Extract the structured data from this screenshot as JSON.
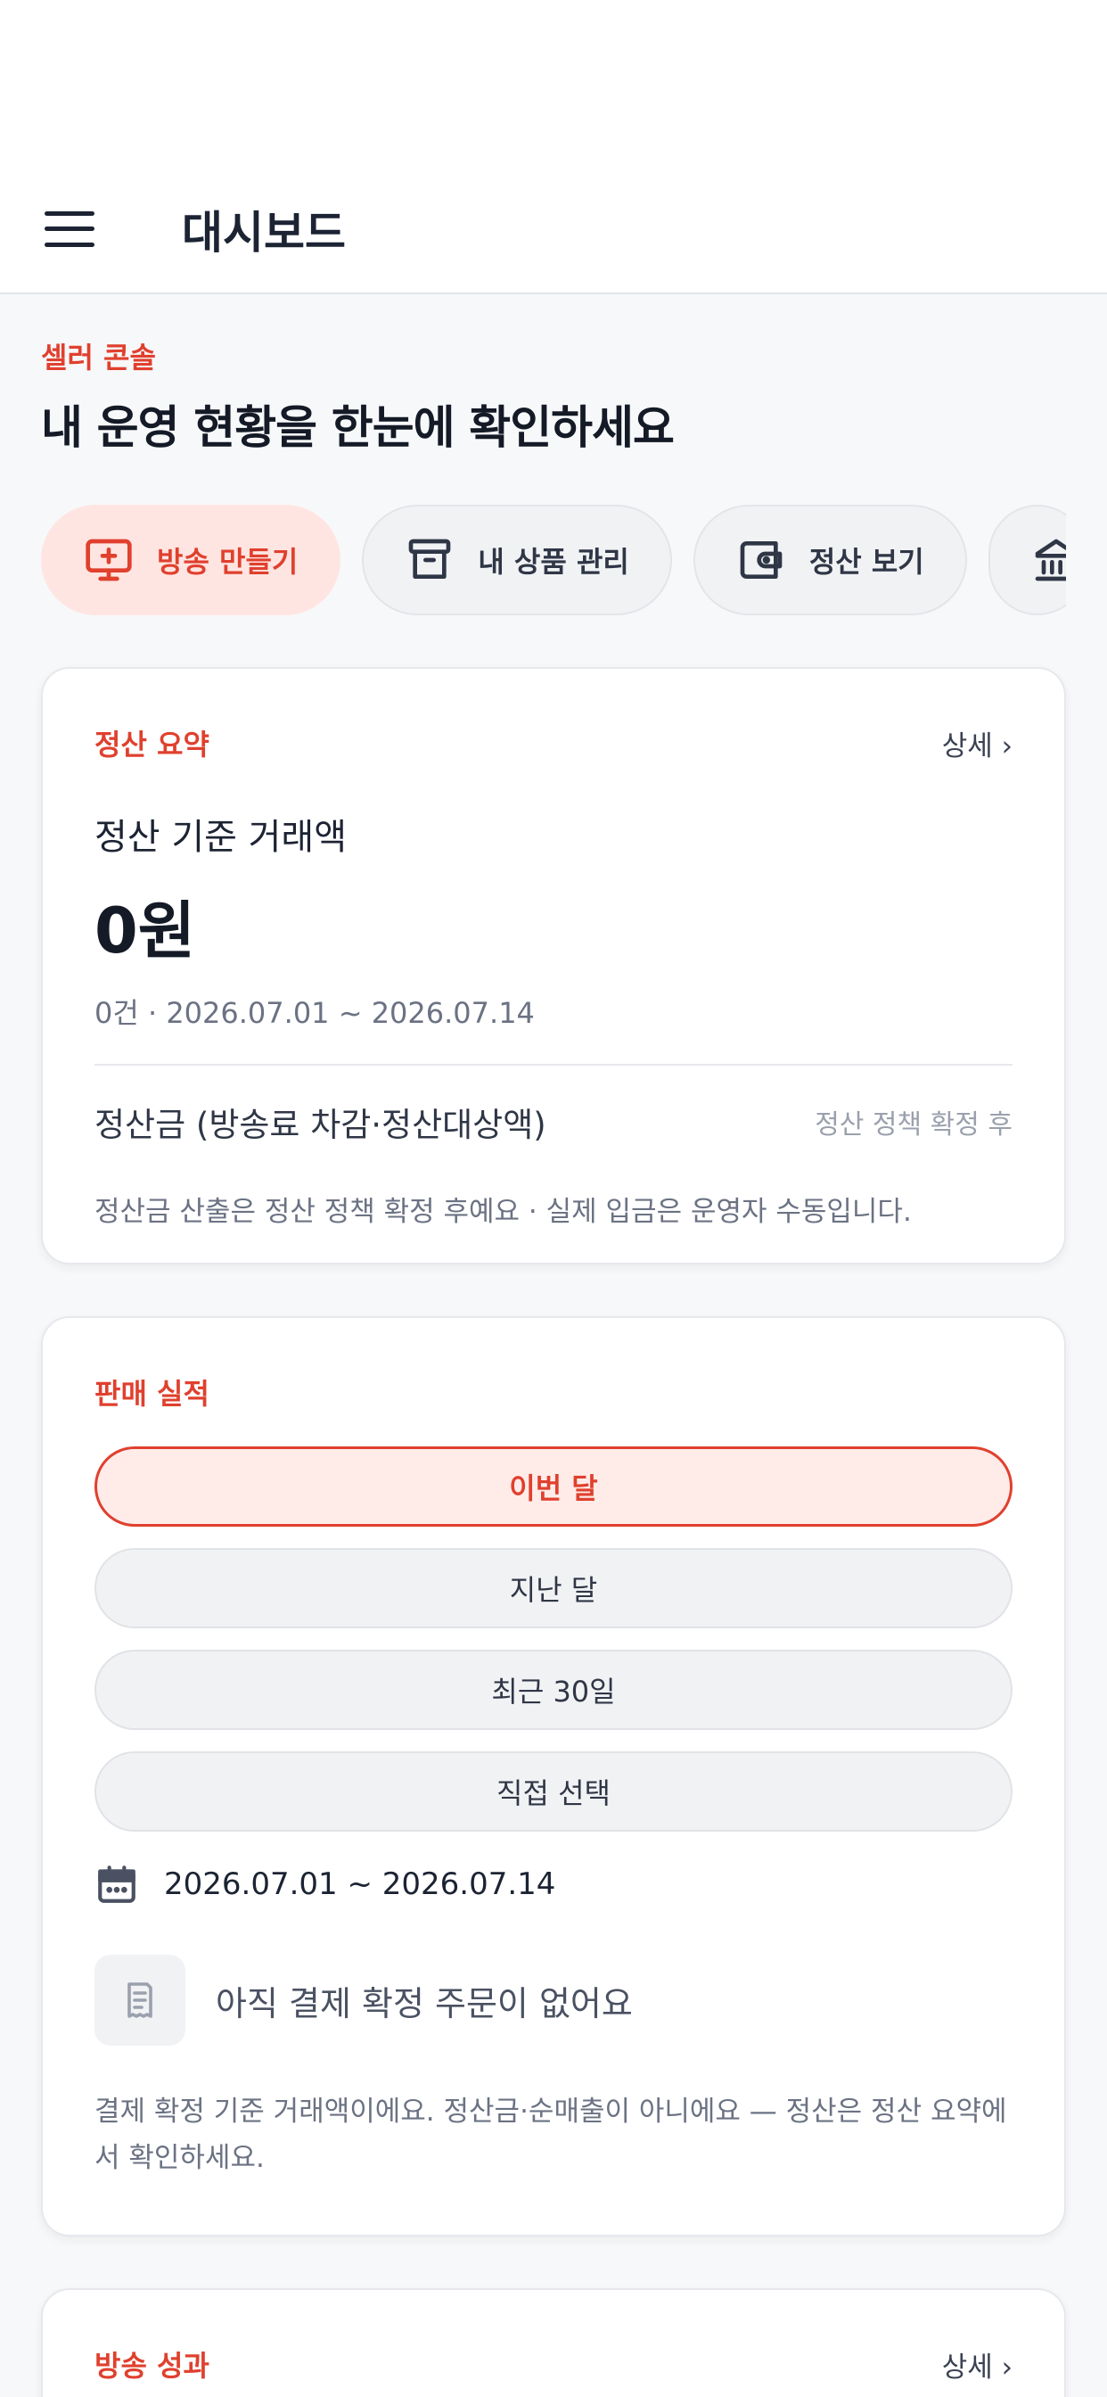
{
  "header": {
    "title": "대시보드"
  },
  "hero": {
    "eyebrow": "셀러 콘솔",
    "title": "내 운영 현황을 한눈에 확인하세요"
  },
  "quick_actions": [
    {
      "label": "방송 만들기",
      "icon": "broadcast-add-icon",
      "active": true
    },
    {
      "label": "내 상품 관리",
      "icon": "archive-box-icon",
      "active": false
    },
    {
      "label": "정산 보기",
      "icon": "wallet-icon",
      "active": false
    },
    {
      "label": "",
      "icon": "bank-icon",
      "active": false
    }
  ],
  "settlement": {
    "label": "정산 요약",
    "detail": "상세 ›",
    "subtitle": "정산 기준 거래액",
    "amount": "0원",
    "meta": "0건 · 2026.07.01 ~ 2026.07.14",
    "payout_label": "정산금 (방송료 차감·정산대상액)",
    "payout_status": "정산 정책 확정 후",
    "note": "정산금 산출은 정산 정책 확정 후예요 · 실제 입금은 운영자 수동입니다."
  },
  "sales": {
    "label": "판매 실적",
    "periods": [
      "이번 달",
      "지난 달",
      "최근 30일",
      "직접 선택"
    ],
    "selected_period": "이번 달",
    "date_range": "2026.07.01 ~ 2026.07.14",
    "empty_text": "아직 결제 확정 주문이 없어요",
    "note": "결제 확정 기준 거래액이에요. 정산금·순매출이 아니에요 — 정산은 정산 요약에서 확인하세요."
  },
  "broadcast": {
    "label": "방송 성과",
    "detail": "상세 ›"
  },
  "colors": {
    "accent": "#e0402e",
    "accent_bg": "#ffe5e1",
    "text": "#1c2333",
    "muted": "#6b7283"
  }
}
